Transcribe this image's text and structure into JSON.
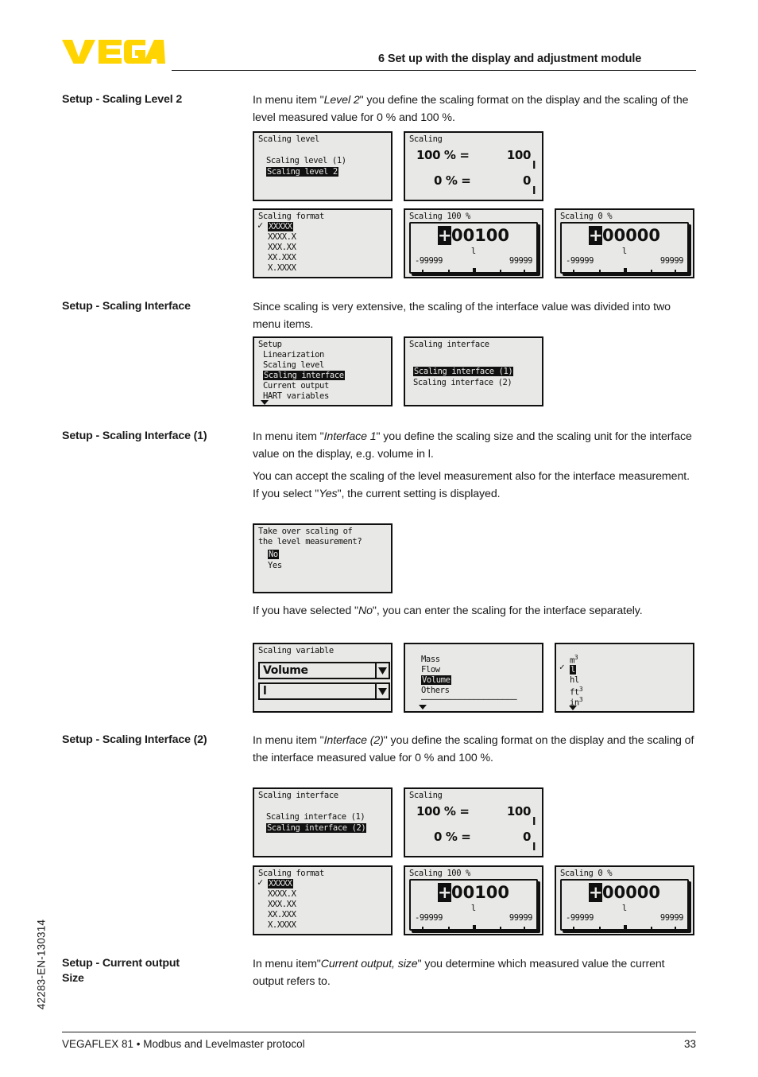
{
  "header": {
    "logo_alt": "VEGA",
    "logo_color": "#FFD400",
    "chapter_title": "6 Set up with the display and adjustment module"
  },
  "footer": {
    "doc_id": "42283-EN-130314",
    "product": "VEGAFLEX 81 • Modbus and Levelmaster protocol",
    "page": "33"
  },
  "sections": [
    {
      "label": "Setup - Scaling Level 2",
      "paragraphs": [
        "In menu item \"Level 2\" you define the scaling format on the display and the scaling of the level measured value for 0 % and 100 %."
      ]
    },
    {
      "label": "Setup - Scaling Interface",
      "paragraphs": [
        "Since scaling is very extensive, the scaling of the interface value was divided into two menu items."
      ]
    },
    {
      "label": "Setup - Scaling Interface (1)",
      "paragraphs": [
        "In menu item \"Interface 1\" you define the scaling size and the scaling unit for the interface value on the display, e.g. volume in l.",
        "You can accept the scaling of the level measurement also for the interface measurement. If you select \"Yes\", the current setting is displayed.",
        "If you have selected \"No\", you can enter the scaling for the interface separately."
      ]
    },
    {
      "label": "Setup - Scaling Interface (2)",
      "paragraphs": [
        "In menu item \"Interface (2)\" you define the scaling format on the display and the scaling of the interface measured value for 0 % and 100 %."
      ]
    },
    {
      "label": "Setup - Current output Size",
      "paragraphs": [
        "In menu item\"Current output, size\" you determine which measured value the current output refers to."
      ]
    }
  ],
  "screens": {
    "scaling_level": {
      "title": "Scaling level",
      "items": [
        "Scaling level (1)",
        "Scaling level 2"
      ],
      "selected": "Scaling level 2"
    },
    "scaling_pct": {
      "title": "Scaling",
      "rows": [
        {
          "left": "100 % =",
          "value": "100",
          "unit": "l"
        },
        {
          "left": "0 % =",
          "value": "0",
          "unit": "l"
        }
      ]
    },
    "scaling_format": {
      "title": "Scaling format",
      "items": [
        "XXXXX",
        "XXXX.X",
        "XXX.XX",
        "XX.XXX",
        "X.XXXX"
      ],
      "selected": "XXXXX"
    },
    "scaling_100": {
      "title": "Scaling 100 %",
      "sign": "+",
      "digits": "00100",
      "unit": "l",
      "min": "-99999",
      "max": "99999"
    },
    "scaling_0": {
      "title": "Scaling 0 %",
      "sign": "+",
      "digits": "00000",
      "unit": "l",
      "min": "-99999",
      "max": "99999"
    },
    "setup_menu": {
      "title": "Setup",
      "items": [
        "Linearization",
        "Scaling level",
        "Scaling interface",
        "Current output",
        "HART variables"
      ],
      "selected": "Scaling interface",
      "more_indicator": "▼"
    },
    "scaling_interface": {
      "title": "Scaling interface",
      "items": [
        "Scaling interface (1)",
        "Scaling interface (2)"
      ],
      "selected": "Scaling interface (1)"
    },
    "take_over": {
      "line1": "Take over scaling of",
      "line2": "the level measurement?",
      "items": [
        "No",
        "Yes"
      ],
      "selected": "No"
    },
    "scaling_variable": {
      "title": "Scaling variable",
      "value": "Volume",
      "unit_value": "l"
    },
    "variable_list": {
      "items": [
        "Mass",
        "Flow",
        "Volume",
        "Others"
      ],
      "selected": "Volume",
      "separator": "––––––––––––––––––––",
      "more_indicator": "▼"
    },
    "unit_list": {
      "items": [
        "m³",
        "l",
        "hl",
        "ft³",
        "in³"
      ],
      "selected": "l",
      "more_indicator": "▼"
    },
    "scaling_interface_2": {
      "title": "Scaling interface",
      "items": [
        "Scaling interface (1)",
        "Scaling interface (2)"
      ],
      "selected": "Scaling interface (2)"
    }
  }
}
